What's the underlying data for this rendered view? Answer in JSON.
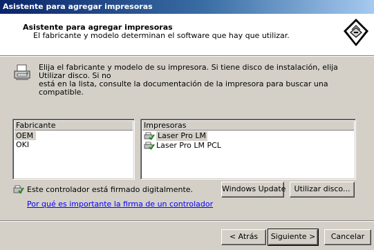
{
  "window": {
    "title": "Asistente para agregar impresoras"
  },
  "header": {
    "title": "Asistente para agregar impresoras",
    "subtitle": "El fabricante y modelo determinan el software que hay que utilizar.",
    "icon": "wizard-printer-icon"
  },
  "info": {
    "icon": "printer-icon",
    "line1": "Elija el fabricante y modelo de su impresora. Si tiene disco de instalación, elija Utilizar disco. Si no",
    "line2": "está en la lista, consulte la documentación de la impresora para buscar una compatible."
  },
  "manufacturers": {
    "header": "Fabricante",
    "items": [
      "OEM",
      "OKI"
    ],
    "selected": "OEM"
  },
  "printers": {
    "header": "Impresoras",
    "items": [
      "Laser Pro LM",
      "Laser Pro LM PCL"
    ],
    "selected": "Laser Pro LM",
    "icon": "signed-driver-icon"
  },
  "buttons": {
    "windows_update": "Windows Update",
    "have_disk": "Utilizar disco...",
    "back": "< Atrás",
    "next": "Siguiente >",
    "cancel": "Cancelar"
  },
  "signature": {
    "text": "Este controlador está firmado digitalmente.",
    "link": "Por qué es importante la firma de un controlador",
    "icon": "signed-driver-icon"
  },
  "colors": {
    "title_start": "#0a246a",
    "title_end": "#a6caf0",
    "face": "#d4d0c8",
    "link": "#0000ff"
  }
}
